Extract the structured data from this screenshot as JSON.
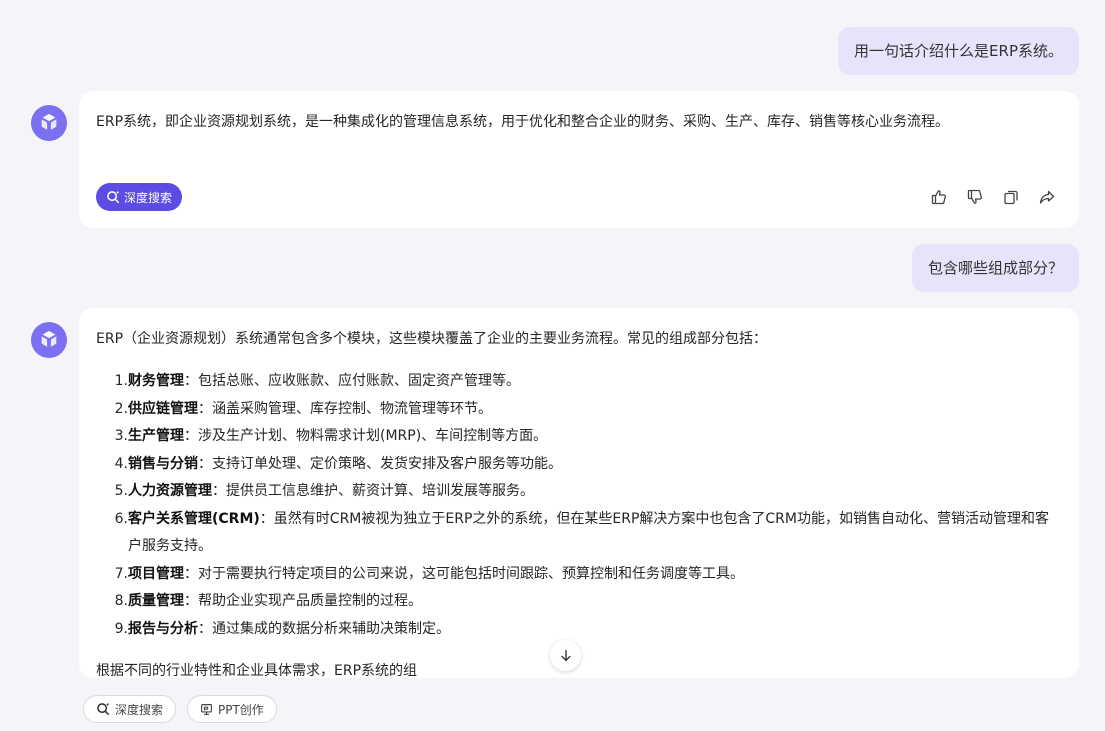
{
  "messages": {
    "user1": "用一句话介绍什么是ERP系统。",
    "assistant1": "ERP系统，即企业资源规划系统，是一种集成化的管理信息系统，用于优化和整合企业的财务、采购、生产、库存、销售等核心业务流程。",
    "user2": "包含哪些组成部分？",
    "assistant2": {
      "intro": "ERP（企业资源规划）系统通常包含多个模块，这些模块覆盖了企业的主要业务流程。常见的组成部分包括：",
      "items": [
        {
          "num": "1.",
          "title": "财务管理",
          "desc": "：包括总账、应收账款、应付账款、固定资产管理等。"
        },
        {
          "num": "2.",
          "title": "供应链管理",
          "desc": "：涵盖采购管理、库存控制、物流管理等环节。"
        },
        {
          "num": "3.",
          "title": "生产管理",
          "desc": "：涉及生产计划、物料需求计划(MRP)、车间控制等方面。"
        },
        {
          "num": "4.",
          "title": "销售与分销",
          "desc": "：支持订单处理、定价策略、发货安排及客户服务等功能。"
        },
        {
          "num": "5.",
          "title": "人力资源管理",
          "desc": "：提供员工信息维护、薪资计算、培训发展等服务。"
        },
        {
          "num": "6.",
          "title": "客户关系管理(CRM)",
          "desc": "：虽然有时CRM被视为独立于ERP之外的系统，但在某些ERP解决方案中也包含了CRM功能，如销售自动化、营销活动管理和客户服务支持。"
        },
        {
          "num": "7.",
          "title": "项目管理",
          "desc": "：对于需要执行特定项目的公司来说，这可能包括时间跟踪、预算控制和任务调度等工具。"
        },
        {
          "num": "8.",
          "title": "质量管理",
          "desc": "：帮助企业实现产品质量控制的过程。"
        },
        {
          "num": "9.",
          "title": "报告与分析",
          "desc": "：通过集成的数据分析来辅助决策制定。"
        }
      ],
      "outro": "根据不同的行业特性和企业具体需求，ERP系统的组"
    }
  },
  "chip_deep_search": "深度搜索",
  "bottom": {
    "deep_search": "深度搜索",
    "ppt": "PPT创作"
  },
  "icons": [
    "avatar-logo-icon",
    "search-icon",
    "thumbs-up-icon",
    "thumbs-down-icon",
    "copy-icon",
    "share-icon",
    "arrow-down-icon",
    "ppt-icon"
  ],
  "colors": {
    "accent": "#5b4ce6",
    "avatar": "#7b6ff2",
    "user_bubble": "#e6e4fb",
    "background": "#f4f4f9"
  }
}
